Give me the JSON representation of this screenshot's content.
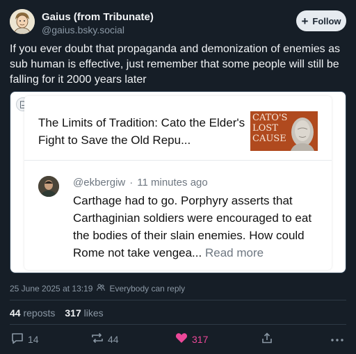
{
  "author": {
    "name": "Gaius (from Tribunate)",
    "handle": "@gaius.bsky.social",
    "follow_label": "Follow"
  },
  "post": {
    "text": "If you ever doubt that propaganda and demonization of enemies as sub human is effective, just remember that some people will still be falling for it 2000 years later"
  },
  "quote": {
    "link_title": "The Limits of Tradition: Cato the Elder's Fight to Save the Old Repu...",
    "thumbnail_lines": [
      "CATO'S",
      "LOST",
      "CAUSE"
    ],
    "reply_handle": "@ekbergiw",
    "reply_separator": "·",
    "reply_time": "11 minutes ago",
    "reply_text": "Carthage had to go. Porphyry asserts that Carthaginian soldiers were encouraged to eat the bodies of their slain enemies. How could Rome not take vengea...",
    "read_more": "Read more"
  },
  "meta": {
    "timestamp": "25 June 2025 at 13:19",
    "reply_setting": "Everybody can reply"
  },
  "stats": {
    "reposts_count": "44",
    "reposts_label": "reposts",
    "likes_count": "317",
    "likes_label": "likes"
  },
  "actions": {
    "reply_count": "14",
    "repost_count": "44",
    "like_count": "317"
  },
  "colors": {
    "background": "#161e27",
    "like_accent": "#ec4899",
    "muted_text": "#8b98a5"
  }
}
